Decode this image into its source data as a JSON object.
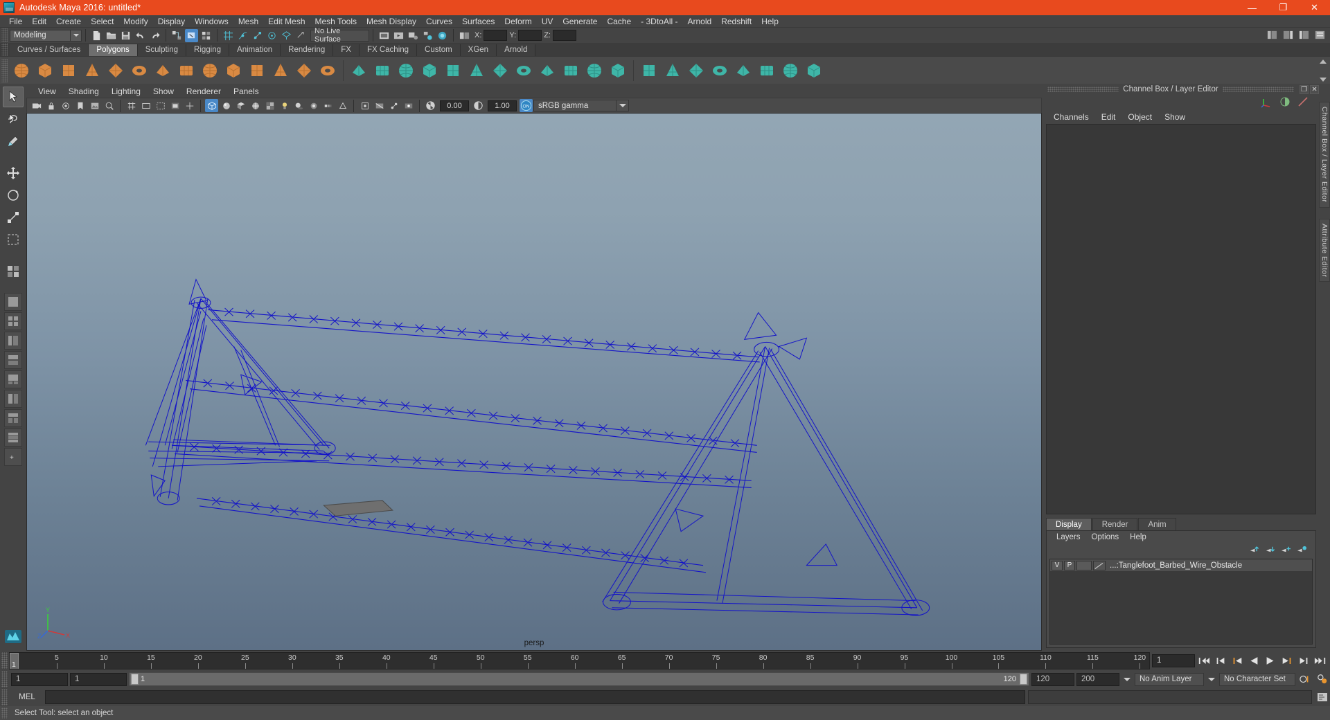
{
  "window": {
    "title": "Autodesk Maya 2016: untitled*",
    "logo_icon": "maya-logo-icon",
    "minimize_label": "—",
    "maximize_label": "❐",
    "close_label": "✕",
    "titlebar_color": "#e84a1e"
  },
  "menubar": {
    "items": [
      "File",
      "Edit",
      "Create",
      "Select",
      "Modify",
      "Display",
      "Windows",
      "Mesh",
      "Edit Mesh",
      "Mesh Tools",
      "Mesh Display",
      "Curves",
      "Surfaces",
      "Deform",
      "UV",
      "Generate",
      "Cache",
      "- 3DtoAll -",
      "Arnold",
      "Redshift",
      "Help"
    ]
  },
  "statusline": {
    "menu_set": "Modeling",
    "live_surface": "No Live Surface",
    "coord_labels": [
      "X:",
      "Y:",
      "Z:"
    ],
    "coord_values": [
      "",
      "",
      ""
    ],
    "icons": [
      "new-scene-icon",
      "open-scene-icon",
      "save-scene-icon",
      "undo-icon",
      "redo-icon",
      "select-by-hierarchy-icon",
      "select-by-object-icon",
      "select-by-component-icon",
      "snap-grid-icon",
      "snap-curve-icon",
      "snap-point-icon",
      "snap-projected-icon",
      "snap-view-plane-icon",
      "make-live-icon",
      "render-current-frame-icon",
      "ipr-render-icon",
      "render-settings-icon",
      "hypershade-icon",
      "render-view-icon",
      "show-hide-editors-icon",
      "sidebar-channelbox-icon",
      "sidebar-attribute-icon",
      "sidebar-toolsettings-icon"
    ]
  },
  "shelf": {
    "tabs": [
      "Curves / Surfaces",
      "Polygons",
      "Sculpting",
      "Rigging",
      "Animation",
      "Rendering",
      "FX",
      "FX Caching",
      "Custom",
      "XGen",
      "Arnold"
    ],
    "active_tab": "Polygons",
    "buttons": [
      "poly-sphere-icon",
      "poly-cube-icon",
      "poly-cylinder-icon",
      "poly-cone-icon",
      "poly-torus-icon",
      "poly-plane-icon",
      "poly-platonic-icon",
      "poly-pyramid-icon",
      "poly-prism-icon",
      "poly-pipe-icon",
      "poly-helix-icon",
      "poly-gear-icon",
      "poly-soccer-icon",
      "poly-super-ellipse-icon",
      "combine-icon",
      "separate-icon",
      "booleans-icon",
      "extract-icon",
      "smooth-icon",
      "reduce-icon",
      "triangulate-icon",
      "quadrangulate-icon",
      "mirror-icon",
      "bevel-icon",
      "bridge-icon",
      "fill-hole-icon",
      "extrude-icon",
      "multi-cut-icon",
      "target-weld-icon",
      "insert-edge-loop-icon",
      "offset-edge-loop-icon",
      "sculpt-icon",
      "crease-icon",
      "connect-icon"
    ]
  },
  "toolbox": {
    "tools": [
      "select-tool-icon",
      "lasso-select-tool-icon",
      "paint-select-tool-icon",
      "move-tool-icon",
      "rotate-tool-icon",
      "scale-tool-icon",
      "last-tool-icon"
    ],
    "layout_buttons": [
      "single-perspective-layout-icon",
      "four-view-layout-icon",
      "outliner-persp-layout-icon",
      "persp-graph-layout-icon",
      "hypershade-persp-layout-icon",
      "two-pane-layout-icon",
      "three-pane-layout-icon",
      "four-pane-layout-icon",
      "more-layouts-icon"
    ],
    "brand_icon": "maya-brand-icon"
  },
  "viewport": {
    "menus": [
      "View",
      "Shading",
      "Lighting",
      "Show",
      "Renderer",
      "Panels"
    ],
    "camera_label": "persp",
    "exposure_value": "0.00",
    "gamma_value": "1.00",
    "color_management_toggle": "ON",
    "view_transform": "sRGB gamma",
    "toolbar_icons": [
      "select-camera-icon",
      "lock-camera-icon",
      "camera-attributes-icon",
      "bookmark-icon",
      "image-plane-icon",
      "two-d-pan-zoom-icon",
      "grid-toggle-icon",
      "film-gate-icon",
      "resolution-gate-icon",
      "gate-mask-icon",
      "film-origin-icon",
      "wireframe-icon",
      "smooth-shade-icon",
      "flat-shade-icon",
      "shaded-wireframe-icon",
      "textured-icon",
      "use-lights-icon",
      "shadows-icon",
      "screen-space-ao-icon",
      "motion-blur-icon",
      "multisample-icon",
      "isolate-select-icon",
      "xray-icon",
      "xray-joints-icon",
      "xray-active-icon",
      "exposure-icon",
      "gamma-icon",
      "color-management-icon"
    ],
    "axis_labels": [
      "Y",
      "X",
      "Z"
    ],
    "scene_object": "Tanglefoot Barbed Wire Obstacle wireframe"
  },
  "channel_box": {
    "panel_title": "Channel Box / Layer Editor",
    "undock_label": "❐",
    "close_label": "✕",
    "menus": [
      "Channels",
      "Edit",
      "Object",
      "Show"
    ],
    "header_icons": [
      "channel-box-icon",
      "attribute-editor-icon",
      "tool-settings-icon"
    ],
    "empty_message": ""
  },
  "layer_editor": {
    "tabs": [
      "Display",
      "Render",
      "Anim"
    ],
    "active_tab": "Display",
    "menus": [
      "Layers",
      "Options",
      "Help"
    ],
    "icons": [
      "move-layer-up-icon",
      "move-layer-down-icon",
      "new-layer-icon",
      "new-layer-from-selected-icon"
    ],
    "layers": [
      {
        "visibility": "V",
        "playback": "P",
        "shading": "",
        "color_swatch": "layer-color-icon",
        "name": "...:Tanglefoot_Barbed_Wire_Obstacle"
      }
    ]
  },
  "right_vtabs": [
    "Channel Box / Layer Editor",
    "Attribute Editor"
  ],
  "timeslider": {
    "start_frame": "1",
    "current_frame": "1",
    "ticks": [
      5,
      10,
      15,
      20,
      25,
      30,
      35,
      40,
      45,
      50,
      55,
      60,
      65,
      70,
      75,
      80,
      85,
      90,
      95,
      100,
      105,
      110,
      115,
      120
    ],
    "range_min": 1,
    "range_max": 120,
    "current_frame_field": "1",
    "playback_buttons": [
      "go-to-start-icon",
      "step-back-frame-icon",
      "step-back-key-icon",
      "play-backwards-icon",
      "play-forwards-icon",
      "step-forward-key-icon",
      "step-forward-frame-icon",
      "go-to-end-icon"
    ]
  },
  "rangeslider": {
    "anim_start": "1",
    "range_start": "1",
    "slider_left_label": "1",
    "slider_right_label": "120",
    "range_end": "120",
    "anim_end": "200",
    "anim_layer": "No Anim Layer",
    "character_set": "No Character Set",
    "icons": [
      "auto-keyframe-icon",
      "animation-preferences-icon"
    ]
  },
  "command_line": {
    "language_label": "MEL",
    "input_value": "",
    "output_value": "",
    "script-editor_icon": "script-editor-icon"
  },
  "helpline": {
    "message": "Select Tool: select an object"
  }
}
